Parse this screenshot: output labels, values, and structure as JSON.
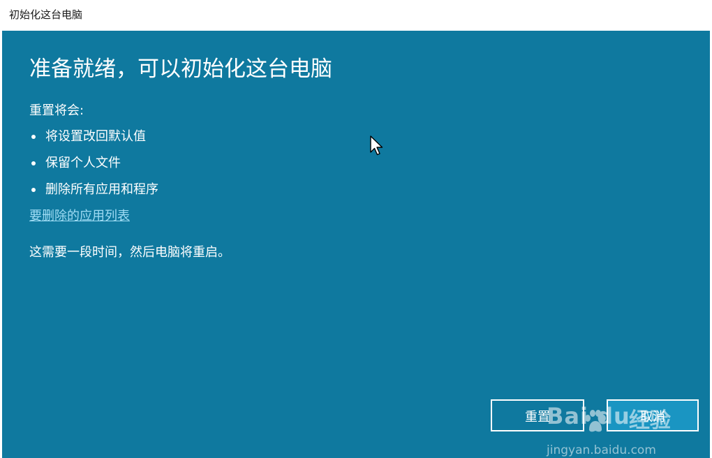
{
  "window": {
    "title": "初始化这台电脑"
  },
  "main": {
    "heading": "准备就绪，可以初始化这台电脑",
    "intro": "重置将会:",
    "bullets": [
      "将设置改回默认值",
      "保留个人文件",
      "删除所有应用和程序"
    ],
    "link": "要删除的应用列表",
    "note": "这需要一段时间，然后电脑将重启。"
  },
  "buttons": {
    "reset": "重置",
    "cancel": "取消"
  },
  "watermark": {
    "logo": "Bai du",
    "brand": "经验",
    "url": "jingyan.baidu.com"
  },
  "colors": {
    "panel": "#0f799f",
    "link": "#9fdcf4",
    "cancel_button": "#1a95c2"
  },
  "icons": {
    "cursor": "mouse-pointer-icon",
    "watermark_paw": "baidu-paw-icon"
  }
}
